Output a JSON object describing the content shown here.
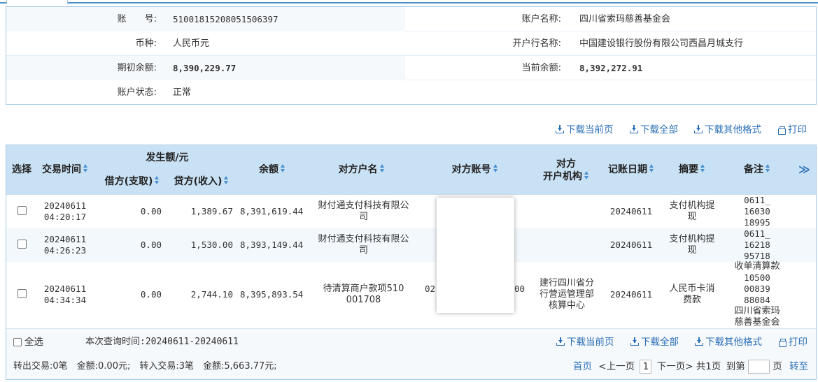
{
  "colors": {
    "accent": "#2a6fb5",
    "header_bg": "#c9e1f4",
    "border": "#a8cbe6"
  },
  "account": {
    "number_label": "账　　号:",
    "number_value": "51001815208051506397",
    "name_label": "账户名称:",
    "name_value": "四川省索玛慈善基金会",
    "currency_label": "币种:",
    "currency_value": "人民币元",
    "bank_label": "开户行名称:",
    "bank_value": "中国建设银行股份有限公司西昌月城支行",
    "opening_balance_label": "期初余额:",
    "opening_balance_value": "8,390,229.77",
    "current_balance_label": "当前余额:",
    "current_balance_value": "8,392,272.91",
    "status_label": "账户状态:",
    "status_value": "正常"
  },
  "toolbar": {
    "download_current": "下载当前页",
    "download_all": "下载全部",
    "download_other": "下载其他格式",
    "print": "打印",
    "icons": {
      "download": "download-icon",
      "print": "print-icon"
    }
  },
  "table": {
    "headers": {
      "select": "选择",
      "time": "交易时间",
      "amount_group": "发生额/元",
      "debit": "借方(支取)",
      "credit": "贷方(收入)",
      "balance": "余额",
      "counterparty_name": "对方户名",
      "counterparty_account": "对方账号",
      "counterparty_bank_line1": "对方",
      "counterparty_bank_line2": "开户机构",
      "posting_date": "记账日期",
      "summary": "摘要",
      "remark": "备注",
      "more": "≫"
    },
    "rows": [
      {
        "date": "20240611",
        "time": "04:20:17",
        "debit": "0.00",
        "credit": "1,389.67",
        "balance": "8,391,619.44",
        "cp_name_1": "财付通支付科技有限公",
        "cp_name_2": "司",
        "cp_account": "",
        "cp_bank_1": "",
        "cp_bank_2": "",
        "cp_bank_3": "",
        "posting_date": "20240611",
        "summary_1": "支付机构提",
        "summary_2": "现",
        "remark_1": "0611_",
        "remark_2": "16030",
        "remark_3": "18995"
      },
      {
        "date": "20240611",
        "time": "04:26:23",
        "debit": "0.00",
        "credit": "1,530.00",
        "balance": "8,393,149.44",
        "cp_name_1": "财付通支付科技有限公",
        "cp_name_2": "司",
        "cp_account": "",
        "cp_bank_1": "",
        "cp_bank_2": "",
        "cp_bank_3": "",
        "posting_date": "20240611",
        "summary_1": "支付机构提",
        "summary_2": "现",
        "remark_1": "0611_",
        "remark_2": "16218",
        "remark_3": "95718"
      },
      {
        "date": "20240611",
        "time": "04:34:34",
        "debit": "0.00",
        "credit": "2,744.10",
        "balance": "8,395,893.54",
        "cp_name_1": "待清算商户款项510",
        "cp_name_2": "001708",
        "cp_account_left": "02",
        "cp_account_right": "00",
        "cp_bank_1": "建行四川省分",
        "cp_bank_2": "行营运管理部",
        "cp_bank_3": "核算中心",
        "posting_date": "20240611",
        "summary_1": "人民币卡消",
        "summary_2": "费款",
        "remark_1": "收单清算款",
        "remark_2": "10500",
        "remark_3": "00839",
        "remark_4": "88084",
        "remark_5": "四川省索玛",
        "remark_6": "慈善基金会"
      }
    ]
  },
  "footer": {
    "select_all": "全选",
    "query_period": "本次查询时间:20240611-20240611",
    "summary_text": "转出交易:0笔　金额:0.00元;　转入交易:3笔　金额:5,663.77元;",
    "first_page": "首页",
    "prev_page": "<上一页",
    "current_page": "1",
    "next_page": "下一页>",
    "total_pages": "共1页",
    "goto_prefix": "到第",
    "goto_suffix": "页",
    "goto_button": "转至"
  }
}
